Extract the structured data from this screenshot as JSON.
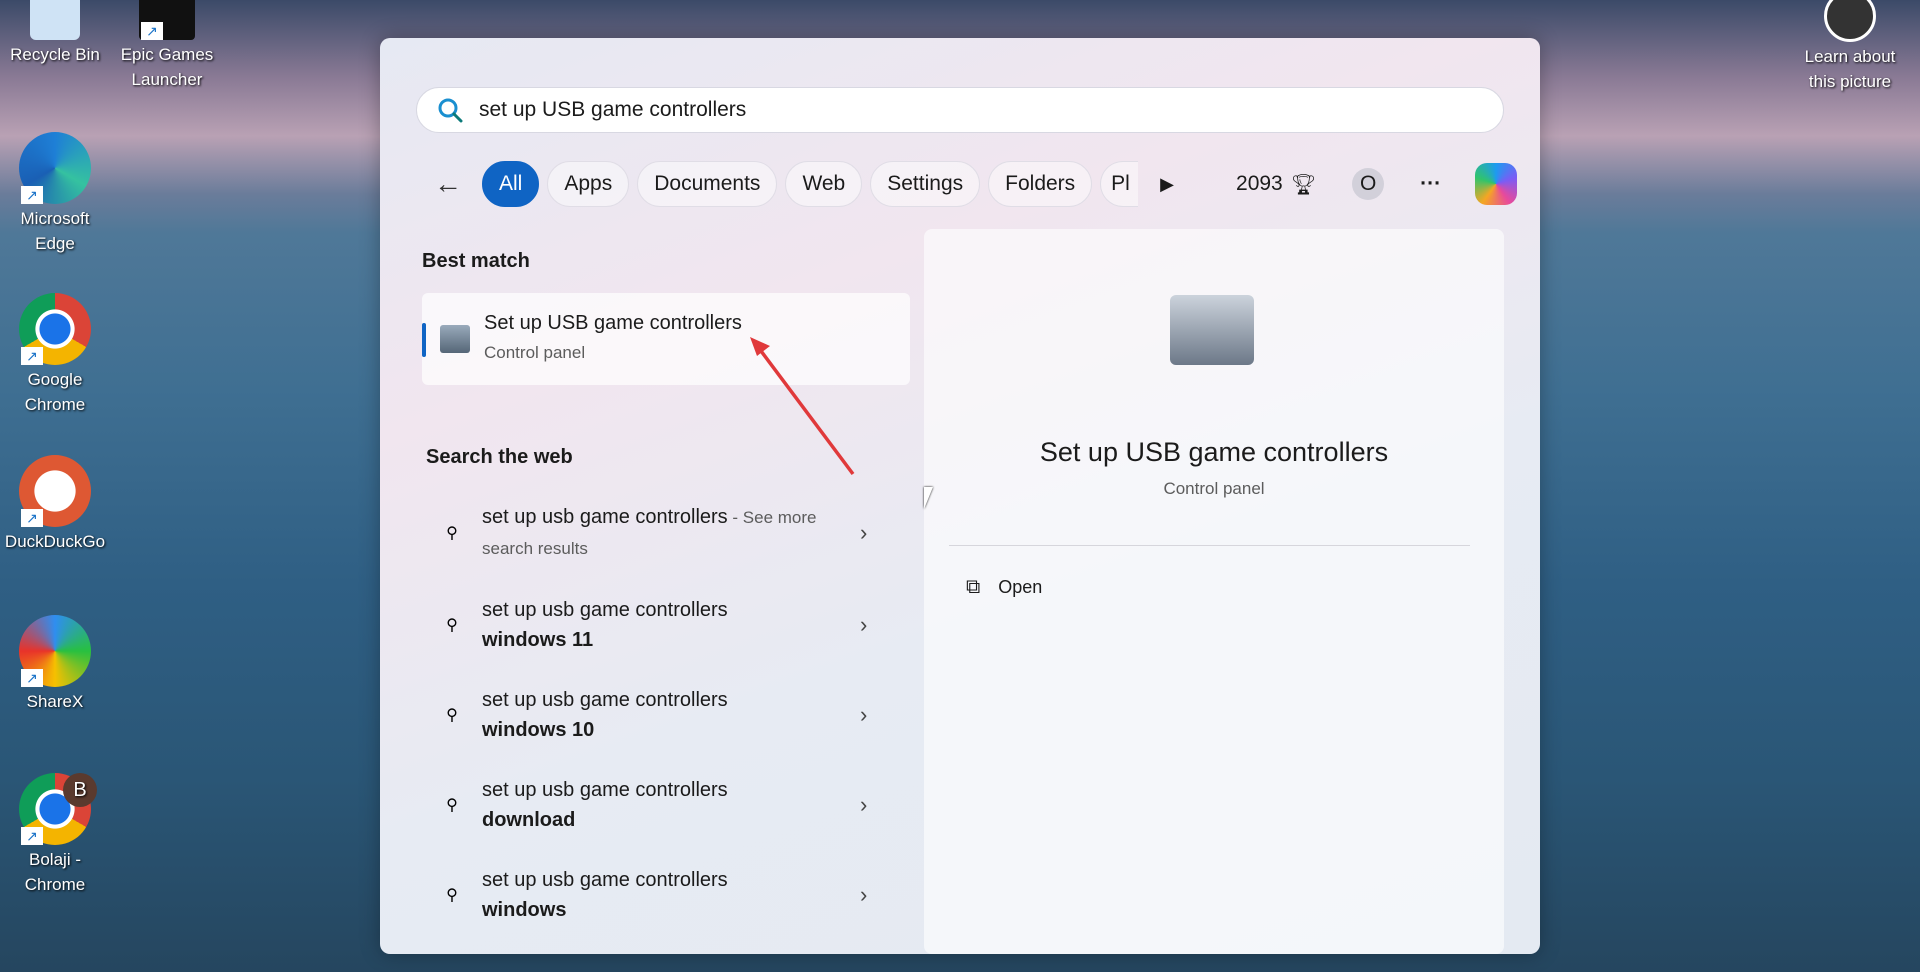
{
  "desktop": {
    "icons": [
      {
        "label": "Recycle Bin"
      },
      {
        "label": "Epic Games Launcher"
      },
      {
        "label": "Microsoft Edge"
      },
      {
        "label": "Google Chrome"
      },
      {
        "label": "DuckDuckGo"
      },
      {
        "label": "ShareX"
      },
      {
        "label": "Bolaji - Chrome",
        "badge": "B"
      }
    ],
    "learn": "Learn about this picture"
  },
  "search": {
    "value": "set up USB game controllers"
  },
  "filters": {
    "items": [
      "All",
      "Apps",
      "Documents",
      "Web",
      "Settings",
      "Folders",
      "Pl"
    ],
    "points": "2093",
    "avatar": "O",
    "more": "···"
  },
  "left": {
    "best_match": "Best match",
    "best": {
      "title": "Set up USB game controllers",
      "subtitle": "Control panel"
    },
    "search_web": "Search the web",
    "web": [
      {
        "main": "set up usb game controllers",
        "suffix": " - See more search results",
        "bold": ""
      },
      {
        "main": "set up usb game controllers",
        "bold": "windows 11"
      },
      {
        "main": "set up usb game controllers",
        "bold": "windows 10"
      },
      {
        "main": "set up usb game controllers",
        "bold": "download"
      },
      {
        "main": "set up usb game controllers",
        "bold": "windows"
      }
    ]
  },
  "right": {
    "title": "Set up USB game controllers",
    "subtitle": "Control panel",
    "open": "Open"
  },
  "colors": {
    "accent": "#0f64c4",
    "arrow": "#e0393b"
  }
}
